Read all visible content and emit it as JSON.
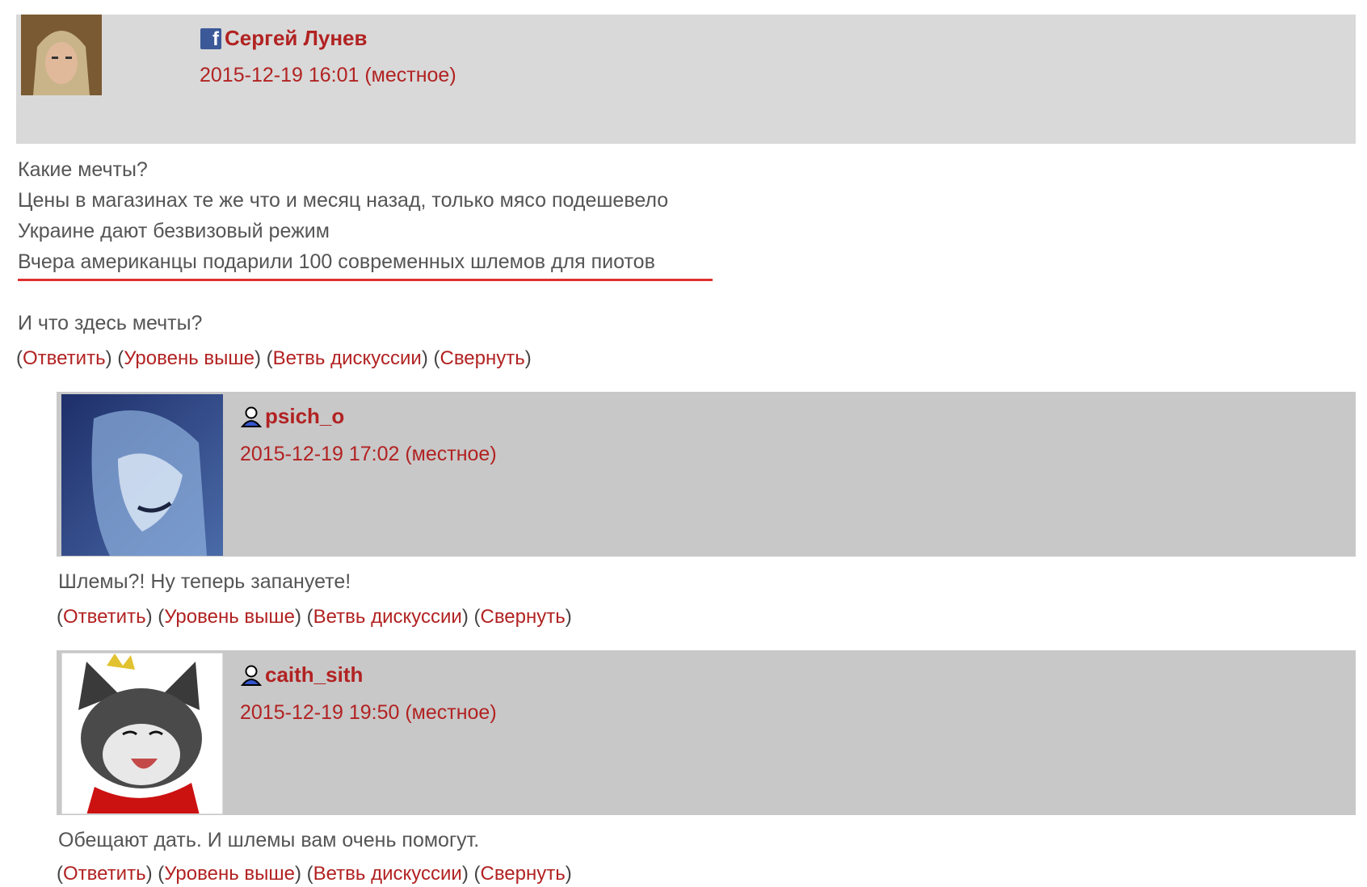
{
  "comments": [
    {
      "user_name": "Сергей Лунев",
      "user_icon": "facebook-icon",
      "date": "2015-12-19 16:01 (местное)",
      "body": [
        "Какие мечты?",
        "Цены в магазинах те же что и месяц назад, только мясо подешевело",
        "Украине дают безвизовый режим",
        "Вчера американцы подарили 100 современных шлемов для пиотов",
        "И что здесь мечты?"
      ],
      "actions": [
        "Ответить",
        "Уровень выше",
        "Ветвь дискуссии",
        "Свернуть"
      ]
    },
    {
      "user_name": "psich_o",
      "user_icon": "user-icon",
      "date": "2015-12-19 17:02 (местное)",
      "body": [
        "Шлемы?! Ну теперь запануете!"
      ],
      "actions": [
        "Ответить",
        "Уровень выше",
        "Ветвь дискуссии",
        "Свернуть"
      ]
    },
    {
      "user_name": "caith_sith",
      "user_icon": "user-icon",
      "date": "2015-12-19 19:50 (местное)",
      "body": [
        "Обещают дать. И шлемы вам очень помогут."
      ],
      "actions": [
        "Ответить",
        "Уровень выше",
        "Ветвь дискуссии",
        "Свернуть"
      ]
    }
  ],
  "colors": {
    "link": "#b22222",
    "header_bg": "#d9d9d9",
    "underline": "#e03030"
  }
}
